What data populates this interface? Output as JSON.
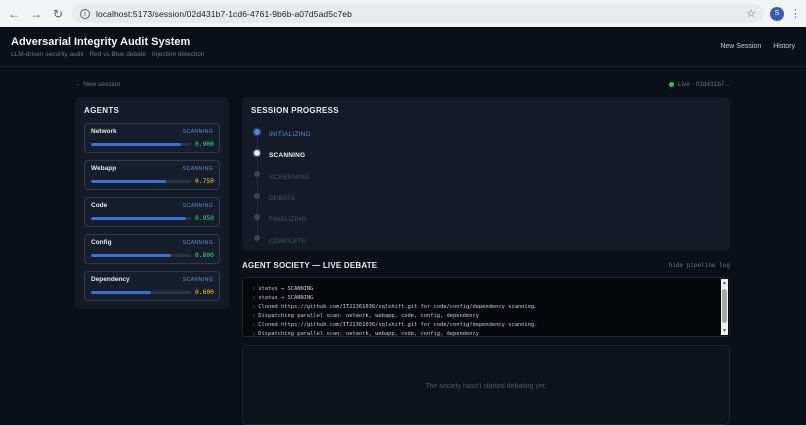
{
  "browser": {
    "url": "localhost:5173/session/02d431b7-1cd6-4761-9b6b-a07d5ad5c7eb",
    "profile_initial": "S"
  },
  "header": {
    "title": "Adversarial Integrity Audit System",
    "subtitle": "LLM-driven security audit · Red vs Blue debate · Injection detection",
    "nav": [
      "New Session",
      "History"
    ]
  },
  "subbar": {
    "back_label": "← New session",
    "live_label": "Live · 02d431b7..."
  },
  "agents": {
    "title": "AGENTS",
    "items": [
      {
        "name": "Network",
        "status": "SCANNING",
        "score": "0.900",
        "progress": 0.9,
        "score_color": "#4ade80"
      },
      {
        "name": "Webapp",
        "status": "SCANNING",
        "score": "0.750",
        "progress": 0.75,
        "score_color": "#facc15"
      },
      {
        "name": "Code",
        "status": "SCANNING",
        "score": "0.950",
        "progress": 0.95,
        "score_color": "#4ade80"
      },
      {
        "name": "Config",
        "status": "SCANNING",
        "score": "0.800",
        "progress": 0.8,
        "score_color": "#4ade80"
      },
      {
        "name": "Dependency",
        "status": "SCANNING",
        "score": "0.600",
        "progress": 0.6,
        "score_color": "#facc15"
      }
    ]
  },
  "progress": {
    "title": "SESSION PROGRESS",
    "steps": [
      {
        "label": "INITIALIZING",
        "state": "done"
      },
      {
        "label": "SCANNING",
        "state": "active"
      },
      {
        "label": "SCREENING",
        "state": "pending"
      },
      {
        "label": "DEBATE",
        "state": "pending"
      },
      {
        "label": "FINALIZING",
        "state": "pending"
      },
      {
        "label": "COMPLETE",
        "state": "pending"
      }
    ]
  },
  "debate": {
    "title": "AGENT SOCIETY — LIVE DEBATE",
    "toggle_label": "hide pipeline log",
    "log": [
      "status → SCANNING",
      "status → SCANNING",
      "Cloned https://github.com/IT21361036/sqlshift.git for code/config/dependency scanning.",
      "Dispatching parallel scan: network, webapp, code, config, dependency",
      "Cloned https://github.com/IT21361036/sqlshift.git for code/config/dependency scanning.",
      "Dispatching parallel scan: network, webapp, code, config, dependency"
    ],
    "empty_message": "The society hasn't started debating yet."
  }
}
